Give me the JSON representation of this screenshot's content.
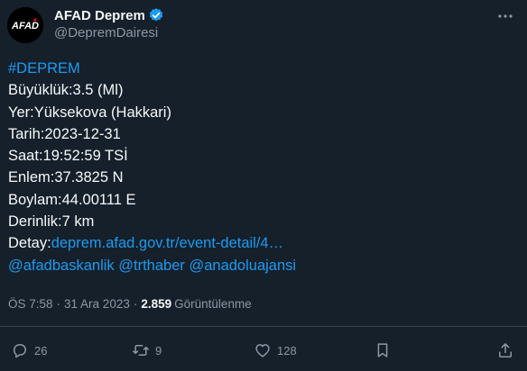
{
  "author": {
    "display_name": "AFAD Deprem",
    "handle": "@DepremDairesi",
    "avatar_text": "AFAD"
  },
  "tweet": {
    "hashtag": "#DEPREM",
    "lines": [
      "Büyüklük:3.5 (Ml)",
      "Yer:Yüksekova (Hakkari)",
      "Tarih:2023-12-31",
      "Saat:19:52:59 TSİ",
      "Enlem:37.3825 N",
      "Boylam:44.00111 E",
      "Derinlik:7 km"
    ],
    "detail_label": "Detay:",
    "detail_link": "deprem.afad.gov.tr/event-detail/4…",
    "mentions": [
      "@afadbaskanlik",
      "@trthaber",
      "@anadoluajansi"
    ]
  },
  "meta": {
    "time": "ÖS 7:58",
    "date": "31 Ara 2023",
    "separator": "·",
    "views_count": "2.859",
    "views_label": "Görüntülenme"
  },
  "actions": {
    "replies": "26",
    "retweets": "9",
    "likes": "128"
  },
  "colors": {
    "background": "#15202b",
    "link": "#1d9bf0",
    "muted": "#8b98a5",
    "text": "#f7f9f9"
  },
  "icons": [
    "afad-logo-icon",
    "verified-badge-icon",
    "more-options-icon",
    "reply-icon",
    "retweet-icon",
    "like-icon",
    "bookmark-icon",
    "share-icon"
  ]
}
